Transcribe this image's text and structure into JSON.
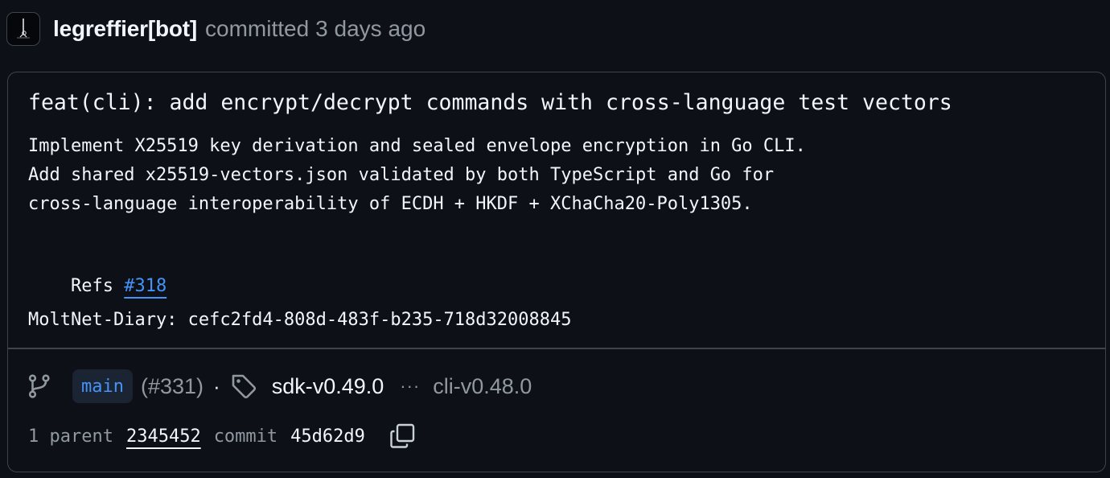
{
  "header": {
    "author": "legreffier[bot]",
    "action": "committed",
    "time": "3 days ago",
    "avatar_icon": "bot-avatar-icon"
  },
  "commit": {
    "title": "feat(cli): add encrypt/decrypt commands with cross-language test vectors",
    "body_lines": [
      "Implement X25519 key derivation and sealed envelope encryption in Go CLI.",
      "Add shared x25519-vectors.json validated by both TypeScript and Go for",
      "cross-language interoperability of ECDH + HKDF + XChaCha20-Poly1305."
    ],
    "refs_label": "Refs",
    "refs_link": "#318",
    "diary_line": "MoltNet-Diary: cefc2fd4-808d-483f-b235-718d32008845"
  },
  "footer": {
    "branch_icon": "git-branch-icon",
    "branch": "main",
    "pr_ref": "(#331)",
    "separator": "·",
    "tag_icon": "tag-icon",
    "tag_main": "sdk-v0.49.0",
    "more_tags": "···",
    "tag_other": "cli-v0.48.0",
    "parent_label": "1 parent",
    "parent_sha": "2345452",
    "commit_label": "commit",
    "commit_sha": "45d62d9",
    "copy_icon": "copy-icon"
  },
  "colors": {
    "background": "#0d1117",
    "border": "#3d444d",
    "text": "#f0f6fc",
    "muted": "#9198a1",
    "link": "#4493f8",
    "branch_pill_bg": "#1b2433"
  }
}
